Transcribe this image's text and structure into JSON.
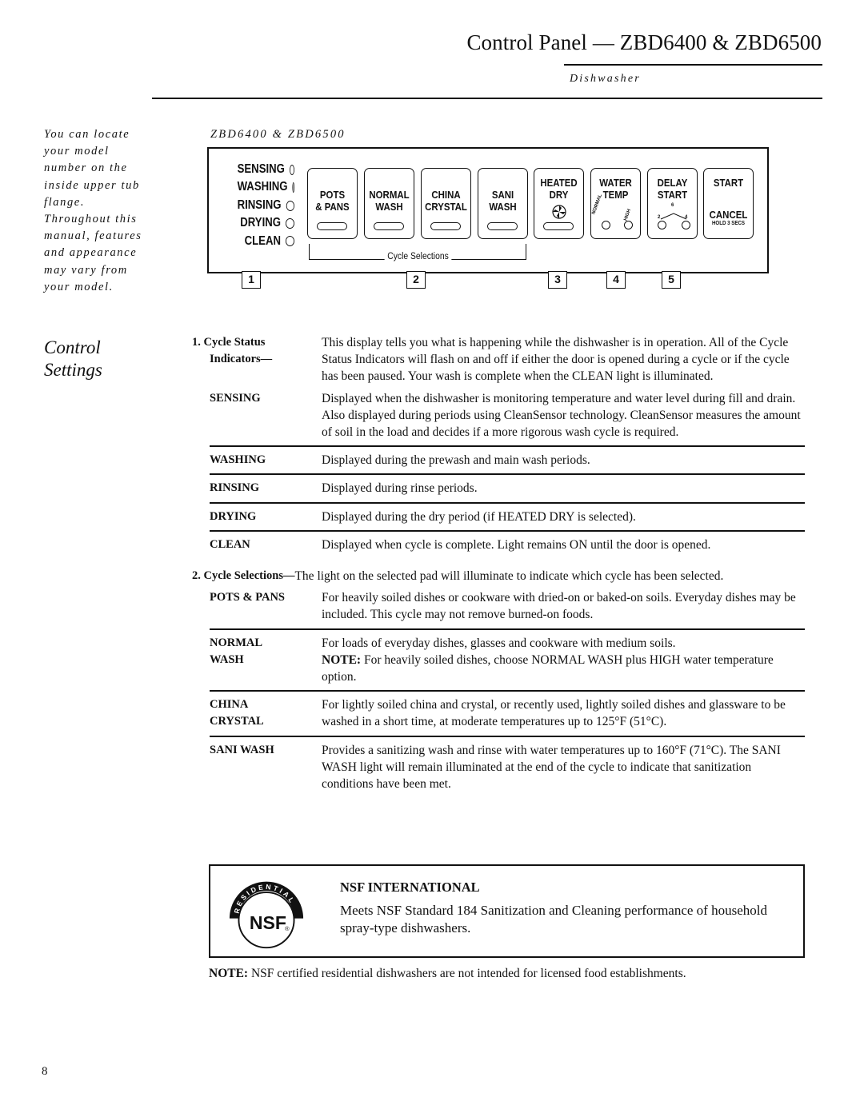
{
  "header": {
    "title": "Control Panel — ZBD6400 & ZBD6500",
    "section": "Dishwasher"
  },
  "sidenote": {
    "lines": [
      "You can locate",
      "your model",
      "number on the",
      "inside upper tub",
      "flange.",
      "Throughout this",
      "manual, features",
      "and appearance",
      "may vary from",
      "your model."
    ]
  },
  "diagram": {
    "model_label": "ZBD6400 & ZBD6500",
    "status_indicators": [
      "SENSING",
      "WASHING",
      "RINSING",
      "DRYING",
      "CLEAN"
    ],
    "pads": [
      {
        "line1": "POTS",
        "line2": "& PANS"
      },
      {
        "line1": "NORMAL",
        "line2": "WASH"
      },
      {
        "line1": "CHINA",
        "line2": "CRYSTAL"
      },
      {
        "line1": "SANI",
        "line2": "WASH"
      },
      {
        "line1": "HEATED",
        "line2": "DRY"
      },
      {
        "line1": "WATER",
        "line2": "TEMP",
        "opt_left": "NORMAL",
        "opt_right": "HIGH"
      },
      {
        "line1": "DELAY",
        "line2": "START",
        "opt_top": "6",
        "opt_left": "2",
        "opt_right": "4"
      },
      {
        "line1": "START",
        "line2": "CANCEL",
        "line3": "HOLD 3 SECS"
      }
    ],
    "cycle_selections_label": "Cycle Selections",
    "callouts": [
      "1",
      "2",
      "3",
      "4",
      "5"
    ]
  },
  "section": {
    "title_line1": "Control",
    "title_line2": "Settings"
  },
  "items": {
    "cycle_status": {
      "term_line1": "1. Cycle Status",
      "term_line2": "Indicators—",
      "desc": "This display tells you what is happening while the dishwasher is in operation. All of the Cycle Status Indicators will flash on and off if either the door is opened during a cycle or if the cycle has been paused. Your wash is complete when the CLEAN light is illuminated.",
      "subs": [
        {
          "term": "SENSING",
          "desc": "Displayed when the dishwasher is monitoring temperature and water level during fill and drain. Also displayed during periods using CleanSensor technology. CleanSensor measures the amount of soil in the load and decides if a more rigorous wash cycle is required."
        },
        {
          "term": "WASHING",
          "desc": "Displayed during the prewash and main wash periods."
        },
        {
          "term": "RINSING",
          "desc": "Displayed during rinse periods."
        },
        {
          "term": "DRYING",
          "desc": "Displayed during the dry period (if HEATED DRY is selected)."
        },
        {
          "term": "CLEAN",
          "desc": "Displayed when cycle is complete. Light remains ON until the door is opened."
        }
      ]
    },
    "cycle_selections": {
      "term": "2. Cycle Selections—",
      "desc": "The light on the selected pad will illuminate to indicate which cycle has been selected.",
      "subs": [
        {
          "term": "POTS & PANS",
          "desc": "For heavily soiled dishes or cookware with dried-on or baked-on soils. Everyday dishes may be included. This cycle may not remove burned-on foods."
        },
        {
          "term_line1": "NORMAL",
          "term_line2": "WASH",
          "desc": "For loads of everyday dishes, glasses and cookware with medium soils.",
          "note_label": "NOTE:",
          "note_text": " For heavily soiled dishes, choose NORMAL WASH plus HIGH water temperature option."
        },
        {
          "term_line1": "CHINA",
          "term_line2": "CRYSTAL",
          "desc": "For lightly soiled china and crystal, or recently used, lightly soiled dishes and glassware to be washed in a short time, at moderate temperatures up to 125°F (51°C)."
        },
        {
          "term": "SANI WASH",
          "desc": "Provides a sanitizing wash and rinse with water temperatures up to 160°F (71°C). The SANI WASH light will remain illuminated at the end of the cycle to indicate that sanitization conditions have been met."
        }
      ]
    }
  },
  "nsf": {
    "logo_arc_text": "RESIDENTIAL",
    "logo_text": "NSF",
    "logo_mark": "®",
    "heading": "NSF INTERNATIONAL",
    "text": "Meets NSF Standard 184 Sanitization and Cleaning performance of household spray-type dishwashers."
  },
  "note": {
    "label": "NOTE:",
    "text": " NSF certified residential dishwashers are not intended for licensed food establishments."
  },
  "page_number": "8"
}
